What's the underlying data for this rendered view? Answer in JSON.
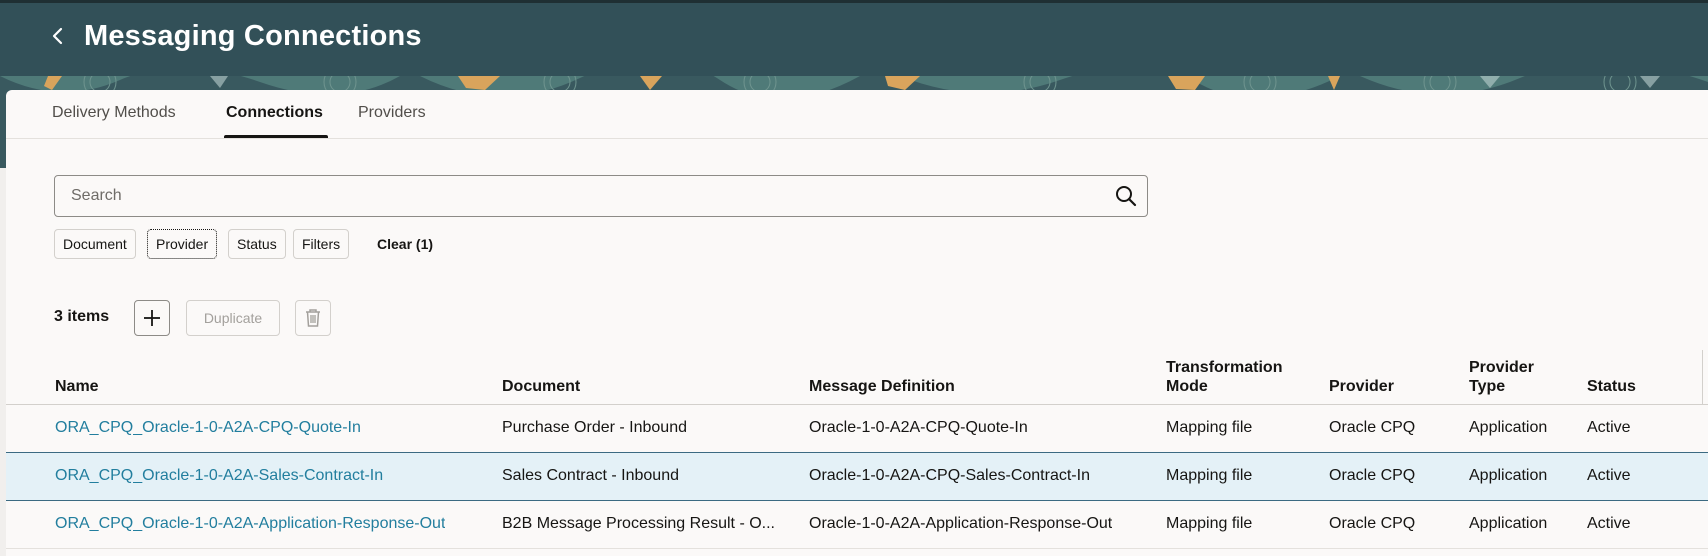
{
  "header": {
    "title": "Messaging Connections",
    "back_icon": "chevron-left-icon"
  },
  "colors": {
    "header_bg": "#325058",
    "link": "#227e9e",
    "selected_row_bg": "#e4f1f7"
  },
  "tabs": [
    {
      "label": "Delivery Methods",
      "selected": false
    },
    {
      "label": "Connections",
      "selected": true
    },
    {
      "label": "Providers",
      "selected": false
    }
  ],
  "search": {
    "placeholder": "Search",
    "value": ""
  },
  "filters": {
    "chips": [
      {
        "label": "Document"
      },
      {
        "label": "Provider"
      },
      {
        "label": "Status"
      },
      {
        "label": "Filters"
      }
    ],
    "clear_label": "Clear (1)"
  },
  "toolbar": {
    "count_label": "3 items",
    "duplicate_label": "Duplicate"
  },
  "table": {
    "columns": [
      "Name",
      "Document",
      "Message Definition",
      "Transformation Mode",
      "Provider",
      "Provider Type",
      "Status"
    ],
    "rows": [
      {
        "name": "ORA_CPQ_Oracle-1-0-A2A-CPQ-Quote-In",
        "document": "Purchase Order - Inbound",
        "message_definition": "Oracle-1-0-A2A-CPQ-Quote-In",
        "transformation_mode": "Mapping file",
        "provider": "Oracle CPQ",
        "provider_type": "Application",
        "status": "Active"
      },
      {
        "name": "ORA_CPQ_Oracle-1-0-A2A-Sales-Contract-In",
        "document": "Sales Contract - Inbound",
        "message_definition": "Oracle-1-0-A2A-CPQ-Sales-Contract-In",
        "transformation_mode": "Mapping file",
        "provider": "Oracle CPQ",
        "provider_type": "Application",
        "status": "Active"
      },
      {
        "name": "ORA_CPQ_Oracle-1-0-A2A-Application-Response-Out",
        "document": "B2B Message Processing Result - O...",
        "message_definition": "Oracle-1-0-A2A-Application-Response-Out",
        "transformation_mode": "Mapping file",
        "provider": "Oracle CPQ",
        "provider_type": "Application",
        "status": "Active"
      }
    ]
  }
}
